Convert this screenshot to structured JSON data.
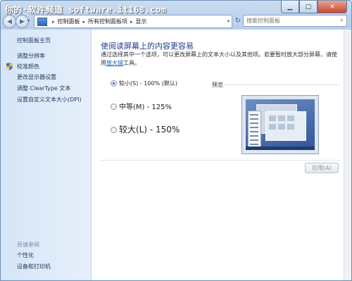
{
  "watermark": "你的·软件频道 software.it168.com",
  "title_buttons": {
    "minimize": "▁",
    "maximize": "□",
    "close": "✕"
  },
  "nav": {
    "back_glyph": "◀",
    "forward_glyph": "▶",
    "drop_glyph": "▾",
    "refresh_glyph": "↻",
    "search_glyph": "⌕"
  },
  "address": {
    "sep": "▸",
    "crumbs": [
      "控制面板",
      "所有控制面板项",
      "显示"
    ],
    "search_placeholder": "搜索控制面板"
  },
  "sidebar": {
    "home": "控制面板主页",
    "links": [
      "调整分辨率",
      "校准颜色",
      "更改显示器设置",
      "调整 ClearType 文本",
      "设置自定义文本大小(DPI)"
    ],
    "see_also_title": "另请参阅",
    "see_also": [
      "个性化",
      "设备和打印机"
    ]
  },
  "main": {
    "heading": "使阅读屏幕上的内容更容易",
    "description": "通过选择其中一个选项，可以更改屏幕上的文本大小以及其他项。若要暂时放大部分屏幕，请使用",
    "magnifier_link": "放大镜",
    "description_end": "工具。",
    "options": [
      {
        "label": "较小(S) - 100% (默认)",
        "selected": true
      },
      {
        "label": "中等(M) - 125%",
        "selected": false
      },
      {
        "label": "较大(L) - 150%",
        "selected": false
      }
    ],
    "preview_label": "预览",
    "apply_label": "应用(A)"
  },
  "colors": {
    "heading": "#1e3f8b",
    "link": "#1a5fb4",
    "sidebar_bg": "#d6e6f8"
  }
}
